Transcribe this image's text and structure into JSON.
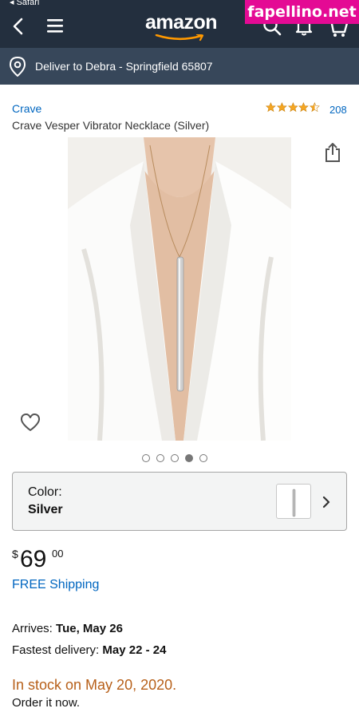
{
  "status_bar": {
    "text": "◂ Safari"
  },
  "header": {
    "logo": "amazon",
    "brand_color": "#232f3e",
    "accent": "#ff9900"
  },
  "watermark": {
    "text": "fapellino.net",
    "color": "#e40a94"
  },
  "delivery": {
    "text": "Deliver to Debra - Springfield 65807"
  },
  "product": {
    "brand": "Crave",
    "rating": 4.5,
    "rating_count": "208",
    "title": "Crave Vesper Vibrator Necklace (Silver)",
    "image_count": 5,
    "active_image": 4
  },
  "variant": {
    "label": "Color:",
    "value": "Silver"
  },
  "price": {
    "currency": "$",
    "whole": "69",
    "fraction": "00"
  },
  "shipping": {
    "text": "FREE Shipping"
  },
  "delivery_info": {
    "arrives_label": "Arrives:",
    "arrives_value": "Tue, May 26",
    "fastest_label": "Fastest delivery:",
    "fastest_value": "May 22 - 24"
  },
  "stock": {
    "text": "In stock on May 20, 2020.",
    "color": "#b7601a",
    "order_text": "Order it now."
  },
  "icons": [
    "back-icon",
    "menu-icon",
    "search-icon",
    "bell-icon",
    "cart-icon",
    "location-pin-icon",
    "share-icon",
    "heart-icon",
    "chevron-right-icon"
  ]
}
